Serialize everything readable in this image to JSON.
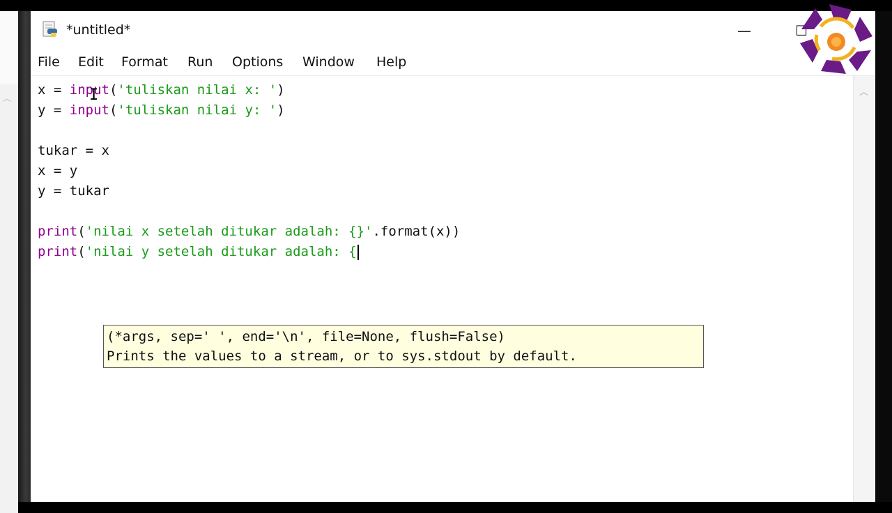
{
  "window": {
    "title": "*untitled*",
    "app_icon": "python-idle-icon",
    "controls": {
      "minimize": "—",
      "maximize": "☐"
    }
  },
  "menu": [
    "File",
    "Edit",
    "Format",
    "Run",
    "Options",
    "Window",
    "Help"
  ],
  "code": {
    "line1": {
      "var": "x = ",
      "fn": "input",
      "open": "(",
      "str": "'tuliskan nilai x: '",
      "close": ")"
    },
    "line2": {
      "var": "y = ",
      "fn": "input",
      "open": "(",
      "str": "'tuliskan nilai y: '",
      "close": ")"
    },
    "line4": "tukar = x",
    "line5": "x = y",
    "line6": "y = tukar",
    "line8": {
      "fn": "print",
      "open": "(",
      "str": "'nilai x setelah ditukar adalah: {}'",
      "rest": ".format(x))"
    },
    "line9": {
      "fn": "print",
      "open": "(",
      "str": "'nilai y setelah ditukar adalah: {"
    }
  },
  "calltip": {
    "signature": "(*args, sep=' ', end='\\n', file=None, flush=False)",
    "doc": "Prints the values to a stream, or to sys.stdout by default."
  },
  "colors": {
    "keyword": "#900090",
    "string": "#1a9a1a",
    "calltip_bg": "#ffffe0"
  },
  "logo_icon": "purple-orange-emblem-logo"
}
